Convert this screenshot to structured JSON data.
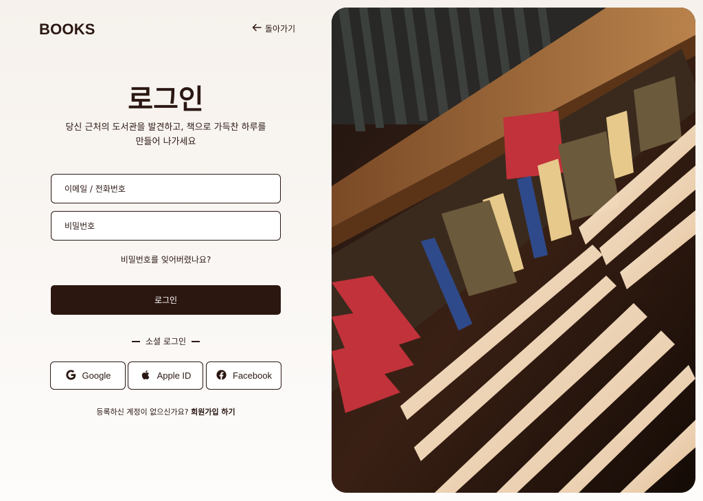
{
  "header": {
    "logo": "BOOKS",
    "back_label": "돌아가기"
  },
  "login": {
    "title": "로그인",
    "subtitle_line1": "당신 근처의 도서관을 발견하고, 책으로 가득찬 하루를",
    "subtitle_line2": "만들어 나가세요",
    "email_placeholder": "이메일 / 전화번호",
    "password_placeholder": "비밀번호",
    "forgot_label": "비밀번호를 잊어버렸나요?",
    "submit_label": "로그인"
  },
  "social": {
    "label": "소셜 로그인",
    "buttons": [
      {
        "label": "Google",
        "icon": "google-icon"
      },
      {
        "label": "Apple ID",
        "icon": "apple-icon"
      },
      {
        "label": "Facebook",
        "icon": "facebook-icon"
      }
    ]
  },
  "signup": {
    "prompt": "등록하신 계정이 없으신가요?",
    "link_label": "회원가입 하기"
  },
  "hero": {
    "image": "bookshelf-photo"
  },
  "colors": {
    "primary": "#2c1610",
    "text": "#2a1712",
    "background": "#f6f1ec"
  }
}
